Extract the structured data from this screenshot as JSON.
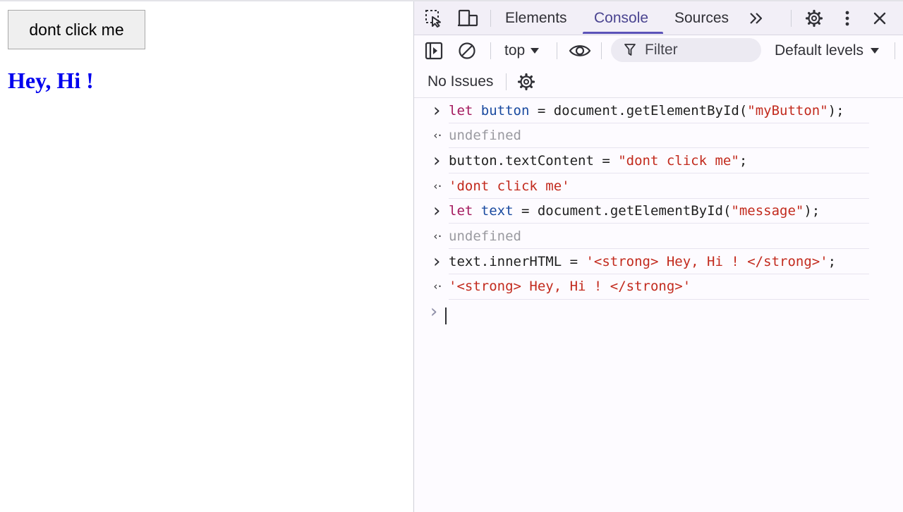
{
  "page": {
    "button_label": "dont click me",
    "heading_text": "Hey, Hi !"
  },
  "devtools": {
    "tabs": [
      {
        "label": "Elements",
        "active": false
      },
      {
        "label": "Console",
        "active": true
      },
      {
        "label": "Sources",
        "active": false
      }
    ],
    "icons": [
      "inspect-element-icon",
      "device-toolbar-icon",
      "more-tabs-icon",
      "settings-icon",
      "more-options-icon",
      "close-icon"
    ],
    "toolbar": {
      "context": "top",
      "filter_placeholder": "Filter",
      "levels": "Default levels"
    },
    "issues": {
      "label": "No Issues"
    },
    "console_entries": [
      {
        "kind": "input",
        "tokens": [
          {
            "t": "let",
            "c": "kw"
          },
          {
            "t": " "
          },
          {
            "t": "button",
            "c": "var"
          },
          {
            "t": " = document.getElementById("
          },
          {
            "t": "\"myButton\"",
            "c": "str"
          },
          {
            "t": ");"
          }
        ]
      },
      {
        "kind": "output",
        "tokens": [
          {
            "t": "undefined",
            "c": "dim"
          }
        ]
      },
      {
        "kind": "input",
        "tokens": [
          {
            "t": "button.textContent = "
          },
          {
            "t": "\"dont click me\"",
            "c": "str"
          },
          {
            "t": ";"
          }
        ]
      },
      {
        "kind": "output",
        "tokens": [
          {
            "t": "'dont click me'",
            "c": "str"
          }
        ]
      },
      {
        "kind": "input",
        "tokens": [
          {
            "t": "let",
            "c": "kw"
          },
          {
            "t": " "
          },
          {
            "t": "text",
            "c": "var"
          },
          {
            "t": " = document.getElementById("
          },
          {
            "t": "\"message\"",
            "c": "str"
          },
          {
            "t": ");"
          }
        ]
      },
      {
        "kind": "output",
        "tokens": [
          {
            "t": "undefined",
            "c": "dim"
          }
        ]
      },
      {
        "kind": "input",
        "tokens": [
          {
            "t": "text.innerHTML = "
          },
          {
            "t": "'<strong> Hey, Hi ! </strong>'",
            "c": "str"
          },
          {
            "t": ";"
          }
        ]
      },
      {
        "kind": "output",
        "tokens": [
          {
            "t": "'<strong> Hey, Hi ! </strong>'",
            "c": "str"
          }
        ]
      }
    ]
  },
  "colors": {
    "heading": "#0000ee",
    "active_tab": "#5b52b8",
    "string": "#c22a1d",
    "keyword": "#a3185d",
    "variable": "#1a4aa0"
  }
}
